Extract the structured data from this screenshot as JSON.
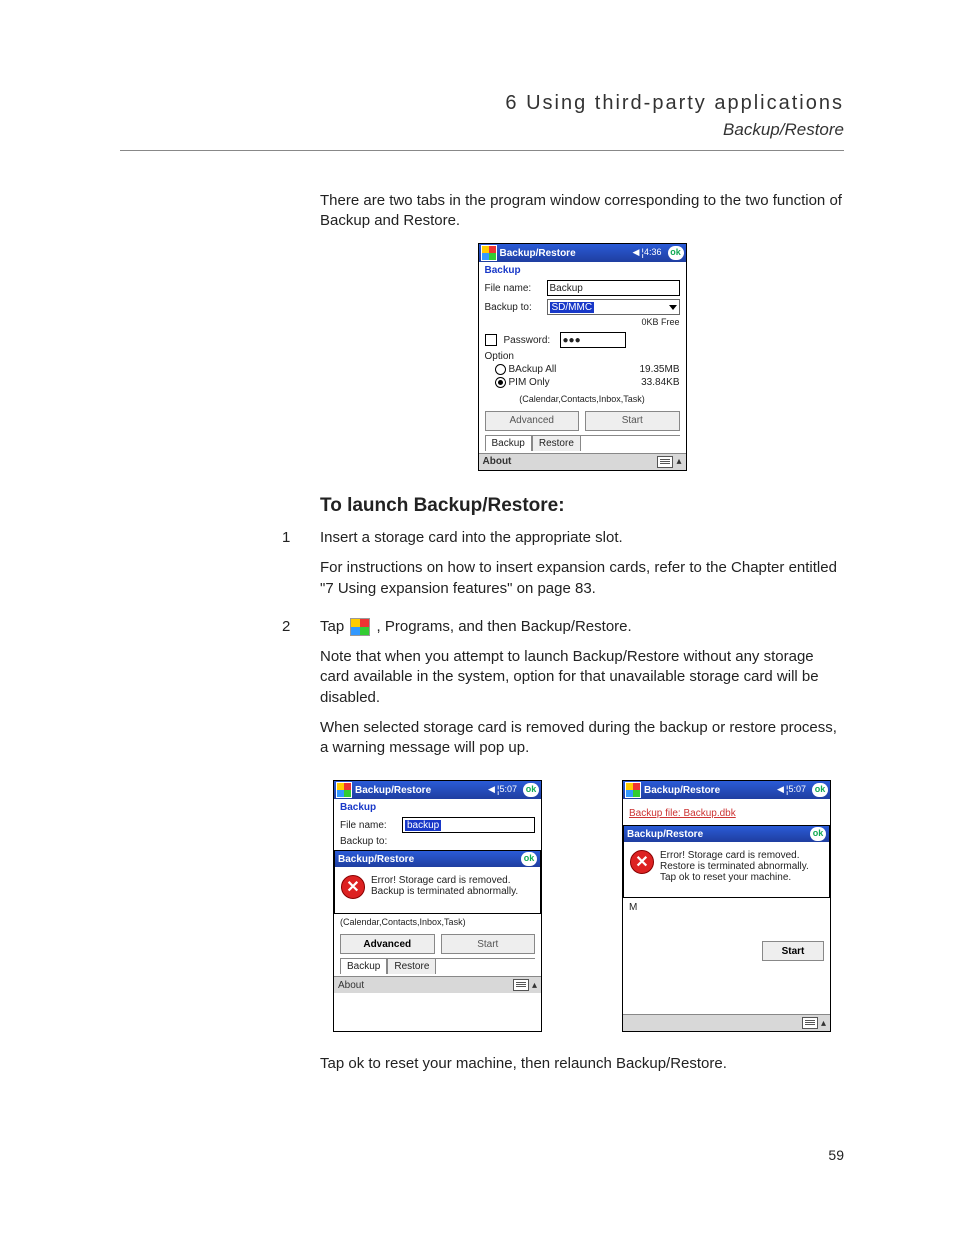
{
  "header": {
    "chapter": "6 Using third-party applications",
    "section": "Backup/Restore"
  },
  "intro": "There are two tabs in the program window corresponding to the two function of Backup and Restore.",
  "fig1": {
    "title": "Backup/Restore",
    "time": "4:36",
    "ok": "ok",
    "section": "Backup",
    "file_label": "File name:",
    "file_value": "Backup",
    "to_label": "Backup to:",
    "to_value": "SD/MMC",
    "free": "0KB Free",
    "pw_label": "Password:",
    "pw_value": "●●●",
    "option": "Option",
    "opt1": "BAckup All",
    "opt1_size": "19.35MB",
    "opt2": "PIM Only",
    "opt2_size": "33.84KB",
    "note": "(Calendar,Contacts,Inbox,Task)",
    "btn_adv": "Advanced",
    "btn_start": "Start",
    "tab_backup": "Backup",
    "tab_restore": "Restore",
    "footer": "About"
  },
  "launch_heading": "To launch Backup/Restore:",
  "steps": {
    "s1": {
      "num": "1",
      "a": "Insert a storage card into the appropriate slot.",
      "b": "For instructions on how to insert expansion cards, refer to the Chapter entitled \"7 Using expansion features\" on page 83."
    },
    "s2": {
      "num": "2",
      "a_pre": "Tap ",
      "a_post": " , Programs, and then Backup/Restore.",
      "b": "Note that when you attempt to launch Backup/Restore without any storage card available in the system, option for that unavailable storage card will be disabled.",
      "c": "When selected storage card is removed during the backup or restore process, a warning message will pop up."
    }
  },
  "fig2": {
    "title": "Backup/Restore",
    "time": "5:07",
    "section": "Backup",
    "file_label": "File name:",
    "file_value": "backup",
    "to_label": "Backup to:",
    "dlg_title": "Backup/Restore",
    "err": "Error! Storage card is removed. Backup is terminated abnormally.",
    "note": "(Calendar,Contacts,Inbox,Task)",
    "btn_adv": "Advanced",
    "btn_start": "Start",
    "tab_backup": "Backup",
    "tab_restore": "Restore",
    "footer": "About"
  },
  "fig3": {
    "title": "Backup/Restore",
    "time": "5:07",
    "file_line": "Backup file: Backup.dbk",
    "dlg_title": "Backup/Restore",
    "err": "Error! Storage card is removed. Restore is terminated abnormally. Tap ok to reset your machine.",
    "side_char": "M",
    "btn_start": "Start"
  },
  "closing": "Tap ok to reset your machine, then relaunch Backup/Restore.",
  "page_number": "59"
}
